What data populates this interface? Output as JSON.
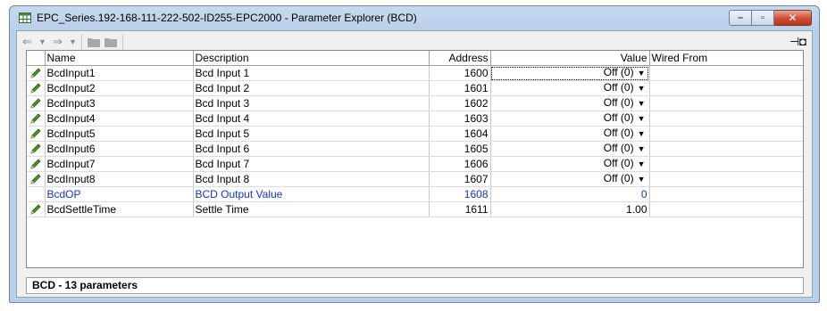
{
  "window": {
    "title": "EPC_Series.192-168-111-222-502-ID255-EPC2000 - Parameter Explorer (BCD)"
  },
  "toolbar": {
    "back_icon": "back-arrow-icon",
    "forward_icon": "forward-arrow-icon",
    "pin_icon": "pin-icon"
  },
  "grid": {
    "columns": [
      "Name",
      "Description",
      "Address",
      "Value",
      "Wired From"
    ],
    "rows": [
      {
        "name": "BcdInput1",
        "description": "Bcd Input 1",
        "address": "1600",
        "value": "Off (0)",
        "wired_from": ""
      },
      {
        "name": "BcdInput2",
        "description": "Bcd Input 2",
        "address": "1601",
        "value": "Off (0)",
        "wired_from": ""
      },
      {
        "name": "BcdInput3",
        "description": "Bcd Input 3",
        "address": "1602",
        "value": "Off (0)",
        "wired_from": ""
      },
      {
        "name": "BcdInput4",
        "description": "Bcd Input 4",
        "address": "1603",
        "value": "Off (0)",
        "wired_from": ""
      },
      {
        "name": "BcdInput5",
        "description": "Bcd Input 5",
        "address": "1604",
        "value": "Off (0)",
        "wired_from": ""
      },
      {
        "name": "BcdInput6",
        "description": "Bcd Input 6",
        "address": "1605",
        "value": "Off (0)",
        "wired_from": ""
      },
      {
        "name": "BcdInput7",
        "description": "Bcd Input 7",
        "address": "1606",
        "value": "Off (0)",
        "wired_from": ""
      },
      {
        "name": "BcdInput8",
        "description": "Bcd Input 8",
        "address": "1607",
        "value": "Off (0)",
        "wired_from": ""
      },
      {
        "name": "BcdOP",
        "description": "BCD Output Value",
        "address": "1608",
        "value": "0",
        "wired_from": ""
      },
      {
        "name": "BcdSettleTime",
        "description": "Settle Time",
        "address": "1611",
        "value": "1.00",
        "wired_from": ""
      }
    ]
  },
  "status": {
    "text": "BCD  -  13 parameters"
  },
  "colors": {
    "readonly_text": "#1432d2",
    "pencil_green": "#3a8a1a",
    "close_red": "#cf4d33"
  }
}
